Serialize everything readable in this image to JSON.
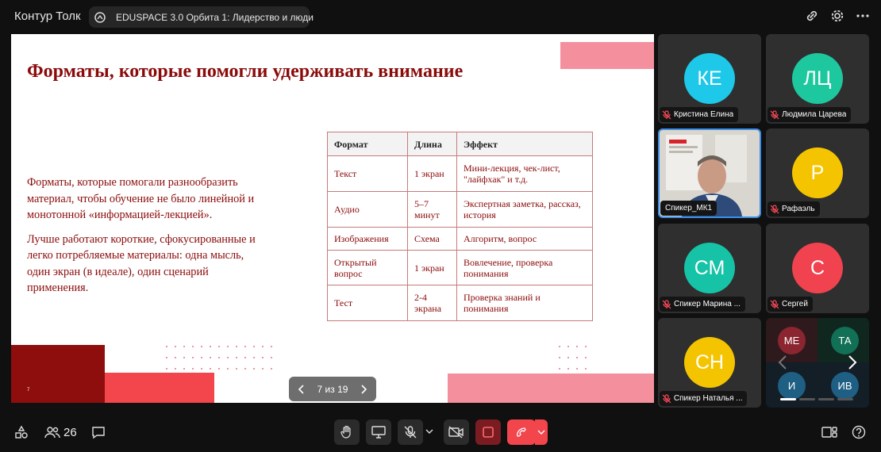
{
  "app": {
    "title": "Контур Толк"
  },
  "meeting": {
    "title": "EDUSPACE 3.0 Орбита 1: Лидерство и люди"
  },
  "slide": {
    "title": "Форматы, которые помогли удерживать внимание",
    "paragraph1": "Форматы, которые помогали разнообразить материал, чтобы обучение не было линейной и монотонной «информацией-лекцией».",
    "paragraph2": "Лучше работают короткие, сфокусированные и легко потребляемые материалы: одна мысль, один экран (в идеале), один сценарий применения.",
    "page_number": "7",
    "table": {
      "headers": [
        "Формат",
        "Длина",
        "Эффект"
      ],
      "rows": [
        [
          "Текст",
          "1 экран",
          "Мини-лекция, чек-лист, \"лайфхак\" и т.д."
        ],
        [
          "Аудио",
          "5–7 минут",
          "Экспертная заметка, рассказ, история"
        ],
        [
          "Изображения",
          "Схема",
          "Алгоритм, вопрос"
        ],
        [
          "Открытый вопрос",
          "1 экран",
          "Вовлечение, проверка понимания"
        ],
        [
          "Тест",
          "2-4 экрана",
          "Проверка знаний и понимания"
        ]
      ]
    }
  },
  "pagination": {
    "label": "7 из 19"
  },
  "participants": {
    "count": "26",
    "tiles": [
      {
        "initials": "КЕ",
        "name": "Кристина Елина",
        "color": "#1ec8e8"
      },
      {
        "initials": "ЛЦ",
        "name": "Людмила Царева",
        "color": "#1ec89e"
      },
      {
        "initials": "",
        "name": "Спикер_МК1",
        "color": "#3b8fe9"
      },
      {
        "initials": "Р",
        "name": "Рафаэль",
        "color": "#f5c400"
      },
      {
        "initials": "СМ",
        "name": "Спикер Марина ...",
        "color": "#16c3a6"
      },
      {
        "initials": "С",
        "name": "Сергей",
        "color": "#f0434f"
      },
      {
        "initials": "СН",
        "name": "Спикер Наталья ...",
        "color": "#f5c400"
      }
    ],
    "mini": [
      {
        "initials": "МЕ",
        "color": "#8b2530"
      },
      {
        "initials": "ТА",
        "color": "#117055"
      },
      {
        "initials": "И",
        "color": "#1f5f84"
      },
      {
        "initials": "ИВ",
        "color": "#1f5f84"
      }
    ]
  }
}
